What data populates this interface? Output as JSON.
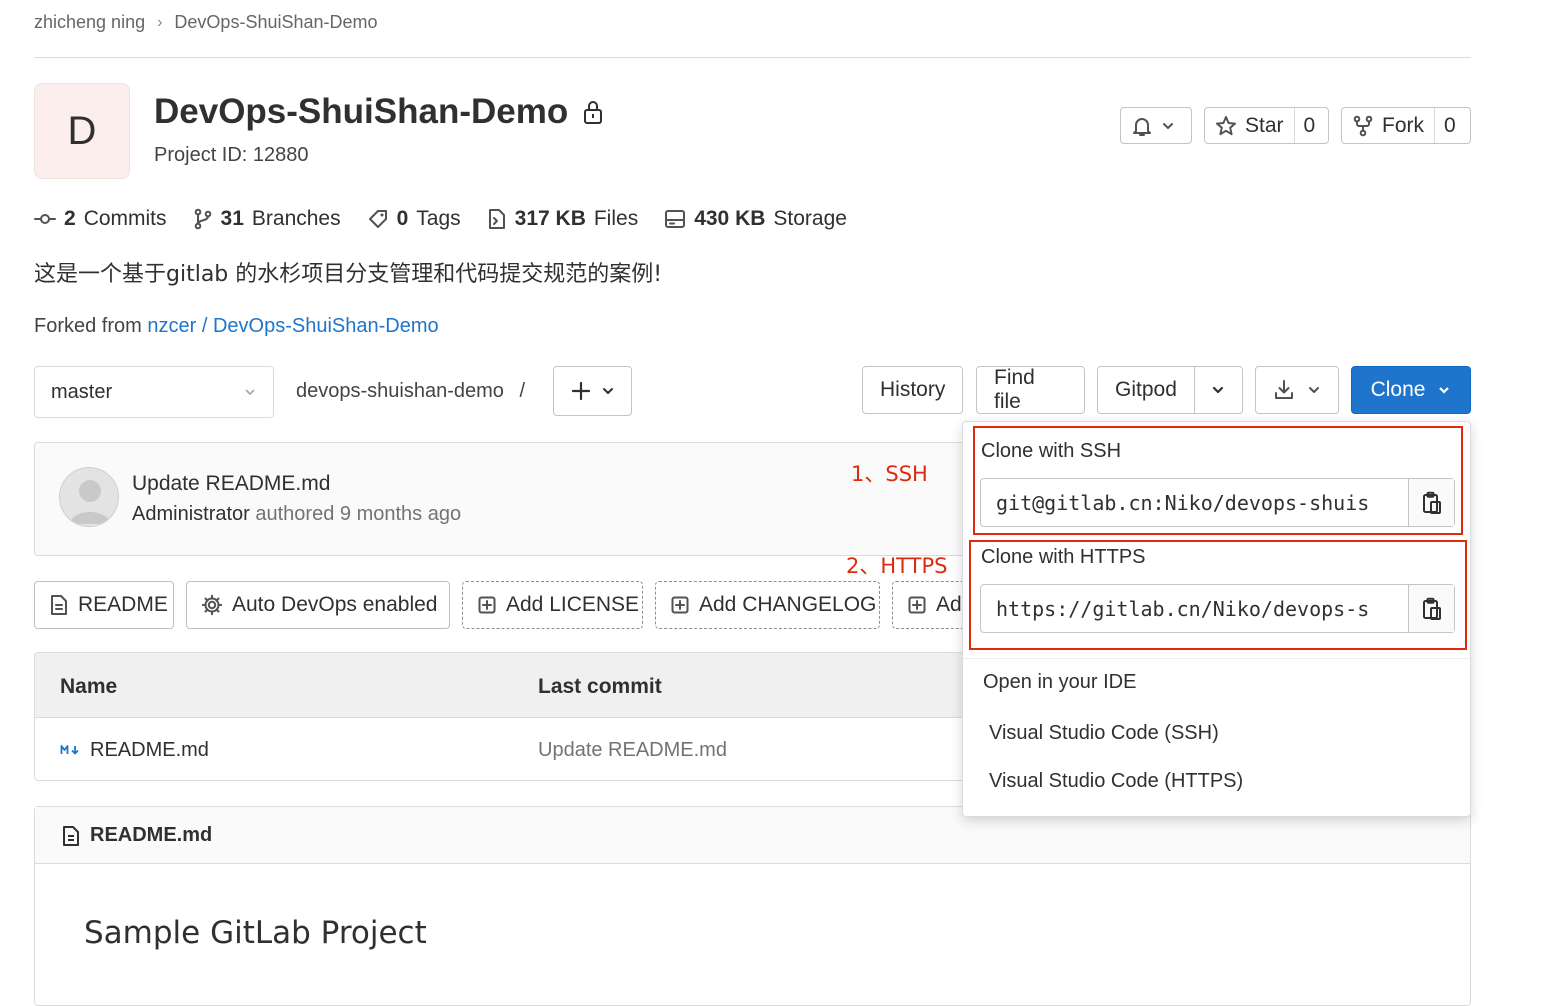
{
  "breadcrumb": {
    "user": "zhicheng ning",
    "project": "DevOps-ShuiShan-Demo"
  },
  "project": {
    "avatar_letter": "D",
    "name": "DevOps-ShuiShan-Demo",
    "id_text": "Project ID: 12880",
    "description": "这是一个基于gitlab 的水杉项目分支管理和代码提交规范的案例!",
    "forked_from_prefix": "Forked from",
    "forked_from_link": "nzcer / DevOps-ShuiShan-Demo"
  },
  "header_buttons": {
    "star_label": "Star",
    "star_count": "0",
    "fork_label": "Fork",
    "fork_count": "0"
  },
  "stats": {
    "commits_num": "2",
    "commits_label": "Commits",
    "branches_num": "31",
    "branches_label": "Branches",
    "tags_num": "0",
    "tags_label": "Tags",
    "files_num": "317 KB",
    "files_label": "Files",
    "storage_num": "430 KB",
    "storage_label": "Storage"
  },
  "toolbar": {
    "branch": "master",
    "path": "devops-shuishan-demo",
    "path_sep": "/",
    "history": "History",
    "find_file": "Find file",
    "gitpod": "Gitpod",
    "clone": "Clone"
  },
  "last_commit": {
    "title": "Update README.md",
    "author": "Administrator",
    "meta": "authored 9 months ago"
  },
  "annotations": {
    "ssh": "1、SSH",
    "https": "2、HTTPS"
  },
  "shortcuts": {
    "readme": "README",
    "autodevops": "Auto DevOps enabled",
    "license": "Add LICENSE",
    "changelog": "Add CHANGELOG",
    "partial": "Ad"
  },
  "file_table": {
    "col_name": "Name",
    "col_commit": "Last commit",
    "rows": [
      {
        "name": "README.md",
        "commit": "Update README.md"
      }
    ]
  },
  "readme": {
    "filename": "README.md",
    "heading": "Sample GitLab Project"
  },
  "clone_dropdown": {
    "ssh_label": "Clone with SSH",
    "ssh_url": "git@gitlab.cn:Niko/devops-shuis",
    "https_label": "Clone with HTTPS",
    "https_url": "https://gitlab.cn/Niko/devops-s",
    "ide_header": "Open in your IDE",
    "ide_ssh": "Visual Studio Code (SSH)",
    "ide_https": "Visual Studio Code (HTTPS)"
  },
  "colors": {
    "accent": "#1f75cb",
    "annotation": "#dd2b0e"
  }
}
